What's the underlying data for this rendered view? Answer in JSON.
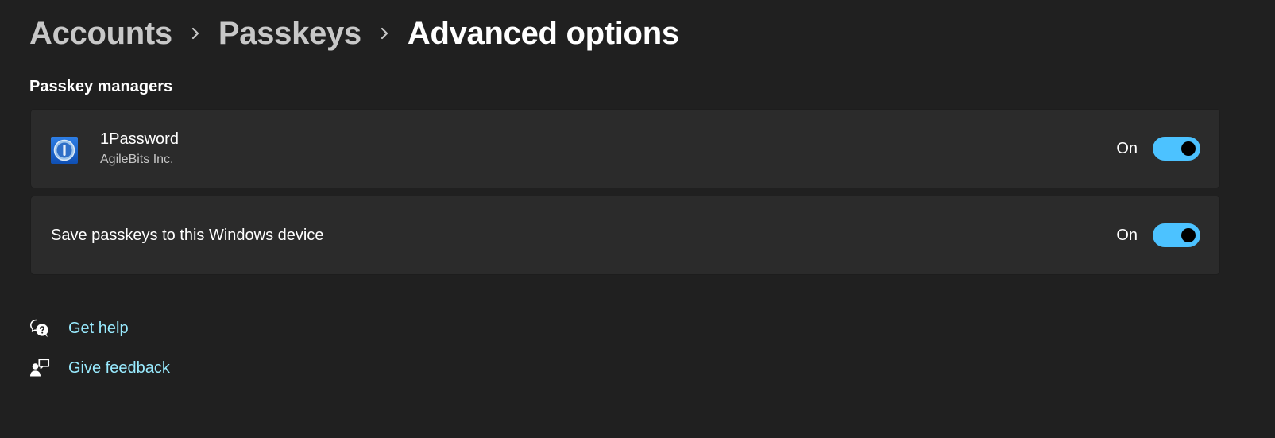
{
  "breadcrumb": {
    "items": [
      "Accounts",
      "Passkeys",
      "Advanced options"
    ]
  },
  "section": {
    "title": "Passkey managers"
  },
  "managers": [
    {
      "name": "1Password",
      "publisher": "AgileBits Inc.",
      "icon": "1password-app-icon",
      "state": "On",
      "enabled": true
    }
  ],
  "save_local": {
    "label": "Save passkeys to this Windows device",
    "state": "On",
    "enabled": true
  },
  "links": {
    "help": {
      "label": "Get help",
      "icon": "help-chat-icon"
    },
    "feedback": {
      "label": "Give feedback",
      "icon": "feedback-icon"
    }
  },
  "colors": {
    "background": "#202020",
    "card": "#2b2b2b",
    "accent": "#4cc2ff",
    "link": "#99ebff"
  }
}
